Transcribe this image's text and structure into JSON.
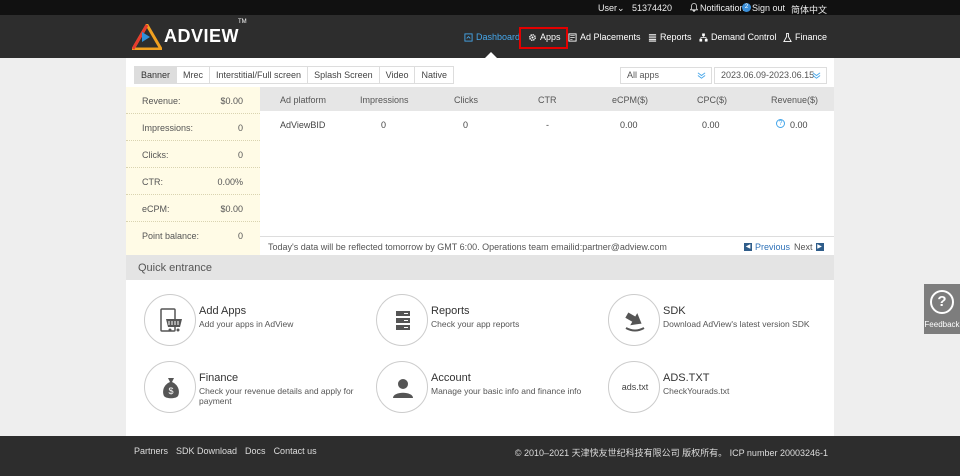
{
  "topbar": {
    "user_label": "User",
    "user_id": "51374420",
    "notification": "Notification",
    "notification_count": "2",
    "sign_out": "Sign out",
    "language": "简体中文"
  },
  "brand": {
    "name": "ADVIEW",
    "tm": "TM"
  },
  "nav": {
    "items": [
      {
        "label": "Dashboard",
        "icon": "dashboard-icon",
        "active": true
      },
      {
        "label": "Apps",
        "icon": "gear-icon"
      },
      {
        "label": "Ad Placements",
        "icon": "ad-placements-icon"
      },
      {
        "label": "Reports",
        "icon": "reports-icon"
      },
      {
        "label": "Demand Control",
        "icon": "network-icon"
      },
      {
        "label": "Finance",
        "icon": "flask-icon"
      }
    ]
  },
  "tabs": [
    "Banner",
    "Mrec",
    "Interstitial/Full screen",
    "Splash Screen",
    "Video",
    "Native"
  ],
  "filters": {
    "app_select": "All apps",
    "date_range": "2023.06.09-2023.06.15"
  },
  "summary": [
    {
      "label": "Revenue:",
      "value": "$0.00"
    },
    {
      "label": "Impressions:",
      "value": "0"
    },
    {
      "label": "Clicks:",
      "value": "0"
    },
    {
      "label": "CTR:",
      "value": "0.00%"
    },
    {
      "label": "eCPM:",
      "value": "$0.00"
    },
    {
      "label": "Point balance:",
      "value": "0"
    }
  ],
  "table": {
    "columns": [
      "Ad platform",
      "Impressions",
      "Clicks",
      "CTR",
      "eCPM($)",
      "CPC($)",
      "Revenue($)"
    ],
    "rows": [
      [
        "AdViewBID",
        "0",
        "0",
        "-",
        "0.00",
        "0.00",
        "0.00"
      ]
    ],
    "note": "Today's data will be reflected tomorrow by GMT 6:00. Operations team emailid:partner@adview.com",
    "previous": "Previous",
    "next": "Next"
  },
  "quick": {
    "title": "Quick entrance",
    "items": [
      {
        "title": "Add Apps",
        "desc": "Add your apps in AdView",
        "icon": "cart-icon"
      },
      {
        "title": "Reports",
        "desc": "Check your app reports",
        "icon": "server-icon"
      },
      {
        "title": "SDK",
        "desc": "Download AdView's latest version SDK",
        "icon": "download-icon"
      },
      {
        "title": "Finance",
        "desc": "Check your revenue details and apply for payment",
        "icon": "money-bag-icon"
      },
      {
        "title": "Account",
        "desc": "Manage your basic info and finance info",
        "icon": "user-icon"
      },
      {
        "title": "ADS.TXT",
        "desc": "CheckYourads.txt",
        "icon_text": "ads.txt"
      }
    ]
  },
  "feedback": {
    "label": "Feedback",
    "glyph": "?"
  },
  "footer": {
    "links": [
      "Partners",
      "SDK Download",
      "Docs",
      "Contact us"
    ],
    "copyright": "© 2010–2021 天津快友世纪科技有限公司 版权所有。 ICP number 20003246-1"
  },
  "colors": {
    "accent": "#45a6ea",
    "header": "#2d2d2d",
    "highlight": "#e30000"
  }
}
